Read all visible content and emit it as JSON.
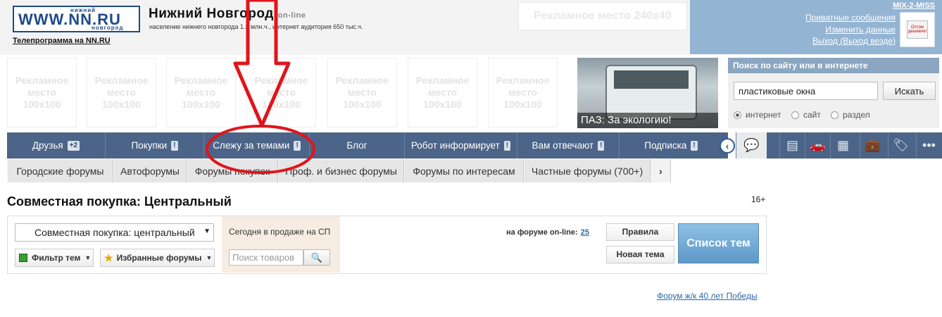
{
  "header": {
    "logo_small_top": "нижний",
    "logo_text": "WWW.NN.RU",
    "logo_small_bottom": "новгород",
    "site_title": "Нижний Новгород",
    "site_title_suffix": "on-line",
    "subtitle": "население нижнего новгорода 1.3 млн.ч., интернет аудитория 650 тыс.ч.",
    "tv_link": "Телепрограмма на NN.RU",
    "ad_banner": "Рекламное место 240x40"
  },
  "user": {
    "name": "MIX-2-MISS",
    "links": [
      "Приватные сообщения",
      "Изменить данные",
      "Выход (Выход везде)"
    ],
    "avatar_text": "Оптом дешевле!"
  },
  "ads": {
    "label": "Рекламное место 100x100",
    "count": 7
  },
  "photo": {
    "caption": "ПАЗ: За экологию!"
  },
  "search": {
    "header": "Поиск по сайту или в интернете",
    "query": "пластиковые окна",
    "button": "Искать",
    "options": [
      "интернет",
      "сайт",
      "раздел"
    ],
    "selected": "интернет"
  },
  "nav": {
    "items": [
      {
        "label": "Друзья",
        "badge": "+2"
      },
      {
        "label": "Покупки",
        "badge": "!"
      },
      {
        "label": "Слежу за темами",
        "badge": "!"
      },
      {
        "label": "Блог",
        "badge": ""
      },
      {
        "label": "Робот информирует",
        "badge": "!"
      },
      {
        "label": "Вам отвечают",
        "badge": "!"
      },
      {
        "label": "Подписка",
        "badge": "!"
      }
    ],
    "back_icon": "chevron-left-icon",
    "icons": [
      "chat-icon",
      "documents-icon",
      "car-icon",
      "building-icon",
      "briefcase-icon",
      "tag-icon",
      "more-icon"
    ]
  },
  "subnav": {
    "items": [
      "Городские форумы",
      "Автофорумы",
      "Форумы покупок",
      "Проф. и бизнес форумы",
      "Форумы по интересам",
      "Частные форумы (700+)"
    ],
    "more": "›"
  },
  "page": {
    "title": "Совместная покупка: Центральный",
    "age_rating": "16+"
  },
  "panel": {
    "forum_select": "Совместная покупка: центральный",
    "filter_button": "Фильтр тем",
    "favorites_button": "Избранные форумы",
    "sale_title": "Сегодня в продаже на СП",
    "product_placeholder": "Поиск товаров",
    "online_label": "на форуме on-line:",
    "online_count": "25",
    "rules_button": "Правила",
    "new_topic_button": "Новая тема",
    "topic_list_button": "Список тем"
  },
  "footer": {
    "forum_link": "Форум ж/к 40 лет Победы"
  },
  "annotation_color": "#e0151b"
}
